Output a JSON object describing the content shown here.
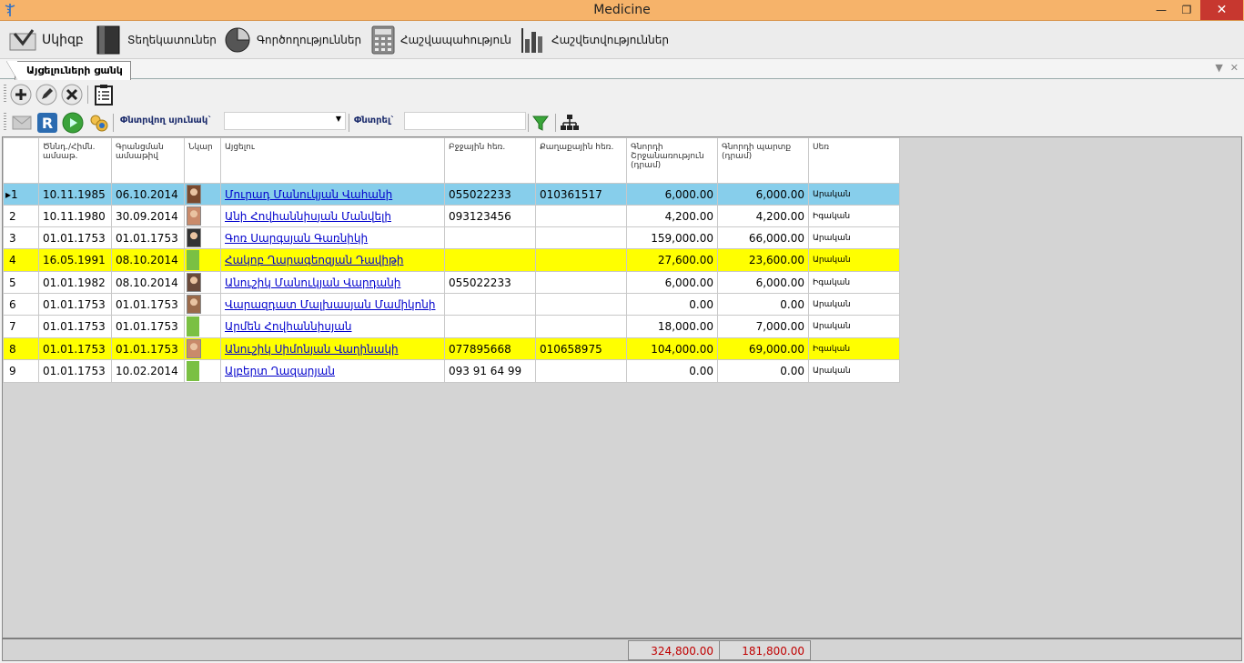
{
  "window": {
    "title": "Medicine",
    "minimize": "—",
    "maximize": "❐",
    "close": "✕"
  },
  "menu": [
    {
      "label": "Սկիզբ",
      "icon": "home-icon"
    },
    {
      "label": "Տեղեկատուներ",
      "icon": "book-icon"
    },
    {
      "label": "Գործողություններ",
      "icon": "pie-chart-icon"
    },
    {
      "label": "Հաշվապահություն",
      "icon": "calculator-icon"
    },
    {
      "label": "Հաշվետվություններ",
      "icon": "bar-chart-icon"
    }
  ],
  "tab": {
    "label": "Այցելուների ցանկ"
  },
  "filter": {
    "column_label": "Փնտրվող սյունակ`",
    "column_value": "",
    "search_label": "Փնտրել`",
    "search_value": ""
  },
  "table": {
    "headers": [
      "",
      "Ծննդ./Հիմն. ամսաթ.",
      "Գրանցման ամսաթիվ",
      "Նկար",
      "Այցելու",
      "Բջջային հեռ.",
      "Քաղաքային հեռ.",
      "Գնորդի Շրջանառություն (դրամ)",
      "Գնորդի պարտք (դրամ)",
      "Սեռ"
    ],
    "rows": [
      {
        "idx": "1",
        "birth": "10.11.1985",
        "reg": "06.10.2014",
        "photo": "photo",
        "name": "Մուրադ Մանուկյան Վահանի",
        "mobile": "055022233",
        "city": "010361517",
        "turnover": "6,000.00",
        "debt": "6,000.00",
        "sex": "Արական",
        "style": "sel"
      },
      {
        "idx": "2",
        "birth": "10.11.1980",
        "reg": "30.09.2014",
        "photo": "photo",
        "name": "Անի Հովհաննիսյան Մանվելի",
        "mobile": "093123456",
        "city": "",
        "turnover": "4,200.00",
        "debt": "4,200.00",
        "sex": "Իգական",
        "style": ""
      },
      {
        "idx": "3",
        "birth": "01.01.1753",
        "reg": "01.01.1753",
        "photo": "photo",
        "name": "Գոռ Սարգսյան Գառնիկի",
        "mobile": "",
        "city": "",
        "turnover": "159,000.00",
        "debt": "66,000.00",
        "sex": "Արական",
        "style": ""
      },
      {
        "idx": "4",
        "birth": "16.05.1991",
        "reg": "08.10.2014",
        "photo": "green",
        "name": "Հակոբ Ղարագեոզյան Դավիթի",
        "mobile": "",
        "city": "",
        "turnover": "27,600.00",
        "debt": "23,600.00",
        "sex": "Արական",
        "style": "yel"
      },
      {
        "idx": "5",
        "birth": "01.01.1982",
        "reg": "08.10.2014",
        "photo": "photo",
        "name": "Անուշիկ Մանուկյան Վարդանի",
        "mobile": "055022233",
        "city": "",
        "turnover": "6,000.00",
        "debt": "6,000.00",
        "sex": "Իգական",
        "style": ""
      },
      {
        "idx": "6",
        "birth": "01.01.1753",
        "reg": "01.01.1753",
        "photo": "photo",
        "name": "Վարազդատ Մալխասյան Մամիկոնի",
        "mobile": "",
        "city": "",
        "turnover": "0.00",
        "debt": "0.00",
        "sex": "Արական",
        "style": ""
      },
      {
        "idx": "7",
        "birth": "01.01.1753",
        "reg": "01.01.1753",
        "photo": "green",
        "name": "Արմեն Հովհաննիսյան ",
        "mobile": "",
        "city": "",
        "turnover": "18,000.00",
        "debt": "7,000.00",
        "sex": "Արական",
        "style": ""
      },
      {
        "idx": "8",
        "birth": "01.01.1753",
        "reg": "01.01.1753",
        "photo": "photo",
        "name": "Անուշիկ  Սիմոնյան Վաղինակի",
        "mobile": "077895668",
        "city": "010658975",
        "turnover": "104,000.00",
        "debt": "69,000.00",
        "sex": "Իգական",
        "style": "yel"
      },
      {
        "idx": "9",
        "birth": "01.01.1753",
        "reg": "10.02.2014",
        "photo": "green",
        "name": "Ալբերտ  Ղազարյան ",
        "mobile": "093 91 64 99",
        "city": "",
        "turnover": "0.00",
        "debt": "0.00",
        "sex": "Արական",
        "style": ""
      }
    ]
  },
  "totals": {
    "turnover": "324,800.00",
    "debt": "181,800.00"
  },
  "colors": {
    "titlebar": "#f6b36a",
    "selected_row": "#87ceeb",
    "highlight_row": "#ffff00",
    "total_text": "#c00000",
    "link": "#0000cc",
    "close_button": "#c7372f"
  }
}
